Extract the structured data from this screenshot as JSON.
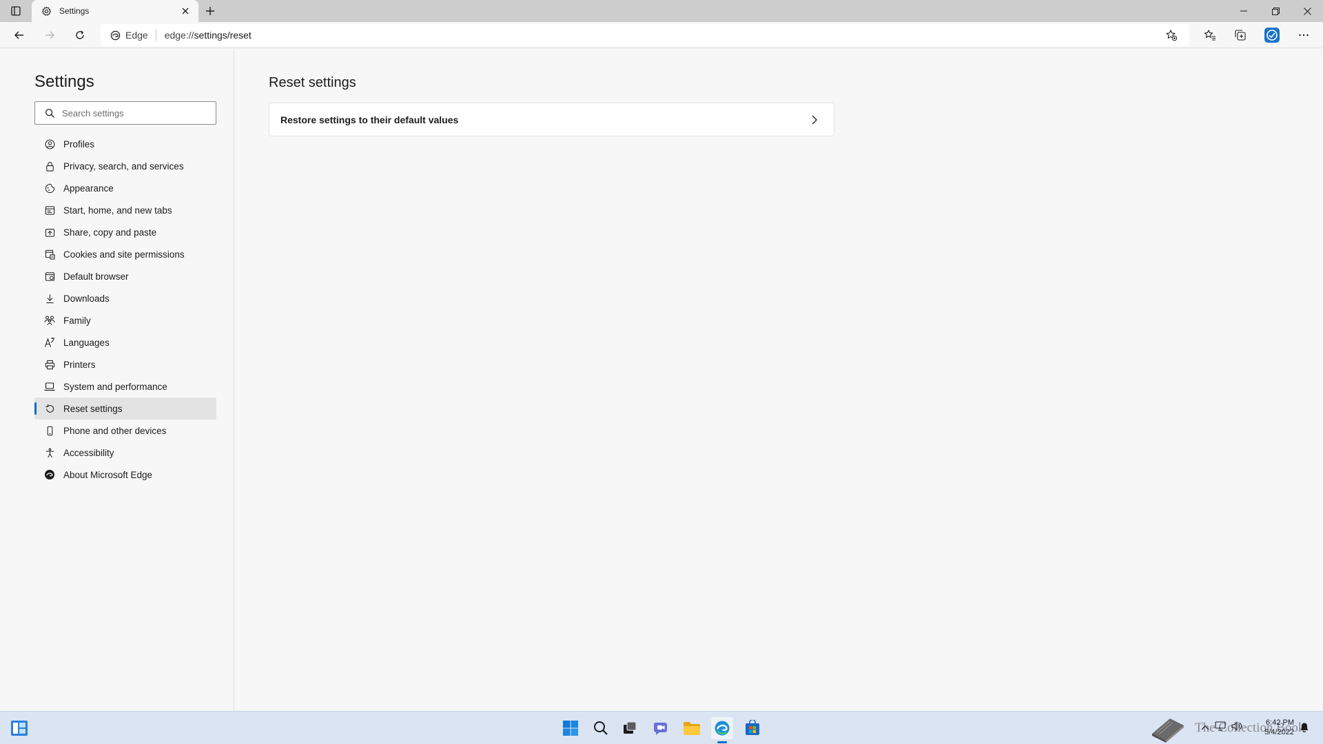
{
  "tab": {
    "title": "Settings"
  },
  "address_bar": {
    "chip_label": "Edge",
    "url_prefix": "edge://",
    "url_path": "settings/reset"
  },
  "sidebar": {
    "title": "Settings",
    "search_placeholder": "Search settings",
    "items": [
      {
        "label": "Profiles",
        "icon": "profile-icon"
      },
      {
        "label": "Privacy, search, and services",
        "icon": "lock-icon"
      },
      {
        "label": "Appearance",
        "icon": "appearance-icon"
      },
      {
        "label": "Start, home, and new tabs",
        "icon": "home-tabs-icon"
      },
      {
        "label": "Share, copy and paste",
        "icon": "share-icon"
      },
      {
        "label": "Cookies and site permissions",
        "icon": "cookies-icon"
      },
      {
        "label": "Default browser",
        "icon": "browser-icon"
      },
      {
        "label": "Downloads",
        "icon": "download-icon"
      },
      {
        "label": "Family",
        "icon": "family-icon"
      },
      {
        "label": "Languages",
        "icon": "languages-icon"
      },
      {
        "label": "Printers",
        "icon": "printer-icon"
      },
      {
        "label": "System and performance",
        "icon": "laptop-icon"
      },
      {
        "label": "Reset settings",
        "icon": "reset-icon",
        "active": true
      },
      {
        "label": "Phone and other devices",
        "icon": "phone-icon"
      },
      {
        "label": "Accessibility",
        "icon": "accessibility-icon"
      },
      {
        "label": "About Microsoft Edge",
        "icon": "edge-icon"
      }
    ]
  },
  "main": {
    "title": "Reset settings",
    "restore_label": "Restore settings to their default values"
  },
  "taskbar": {
    "watermark": "The Collection Book",
    "time": "6:42 PM",
    "date": "5/4/2022"
  },
  "colors": {
    "accent": "#0f6cbd",
    "taskbar": "#dae4f3",
    "chrome": "#cdcdcd"
  }
}
